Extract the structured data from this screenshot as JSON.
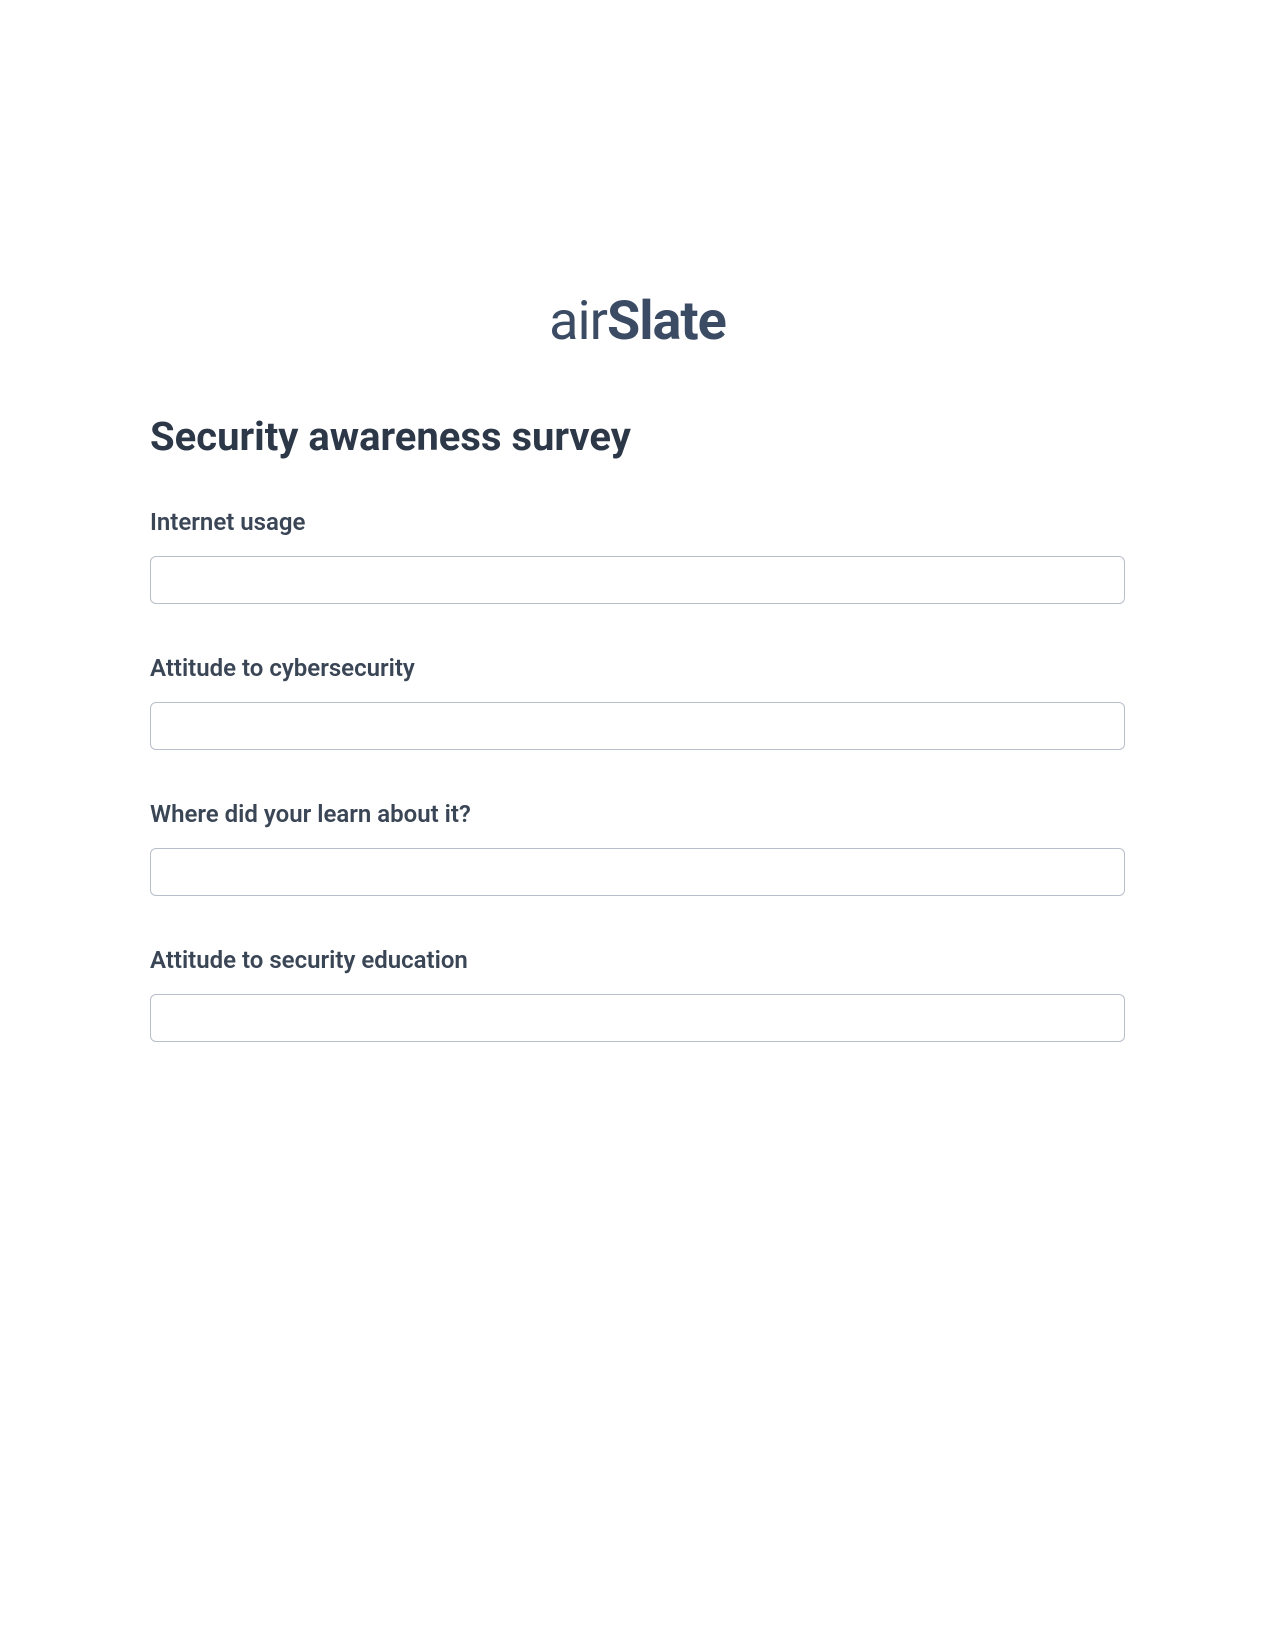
{
  "logo": {
    "prefix": "air",
    "suffix": "Slate"
  },
  "form": {
    "title": "Security awareness survey",
    "fields": [
      {
        "label": "Internet usage",
        "value": ""
      },
      {
        "label": "Attitude to cybersecurity",
        "value": ""
      },
      {
        "label": "Where did your learn about it?",
        "value": ""
      },
      {
        "label": "Attitude to security education",
        "value": ""
      }
    ]
  }
}
